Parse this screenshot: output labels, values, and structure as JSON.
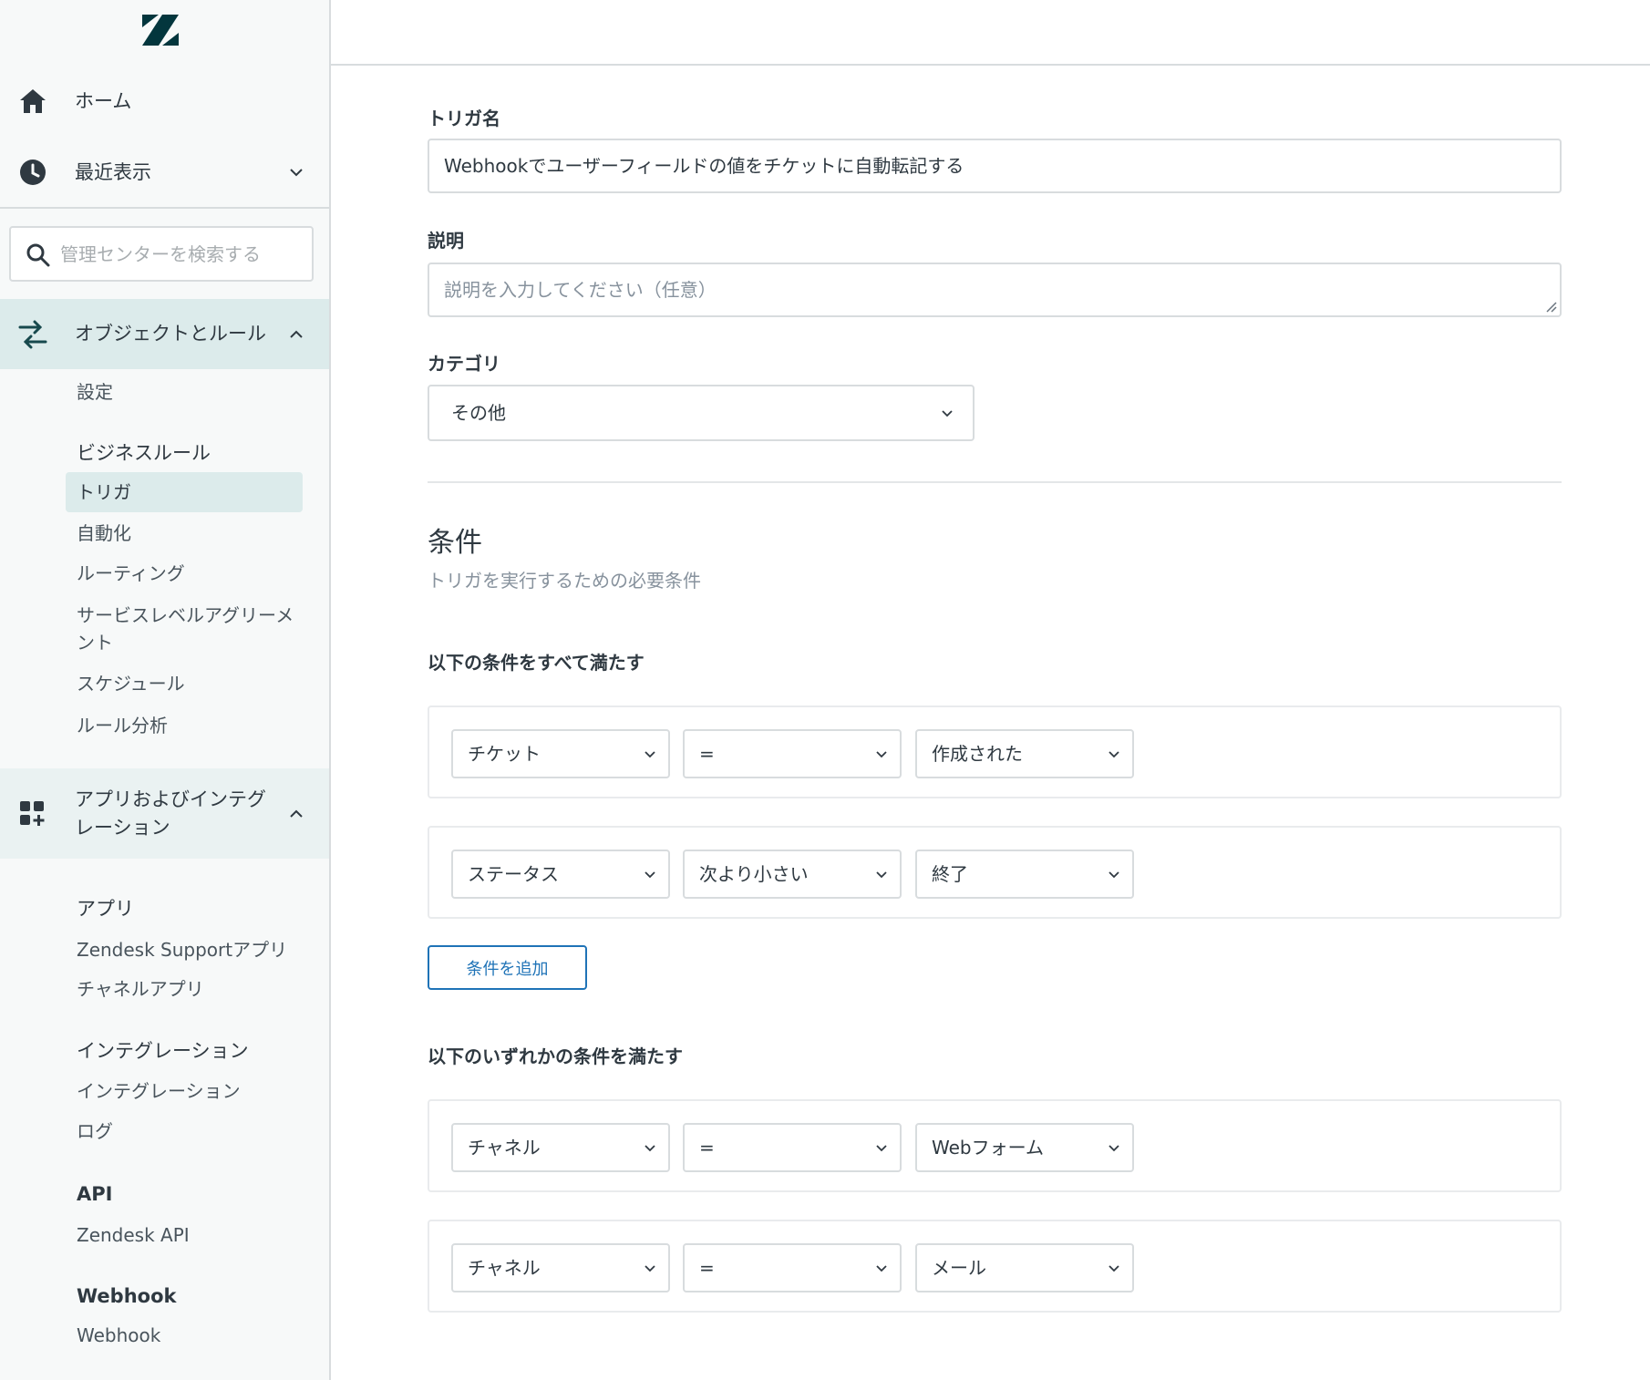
{
  "sidebar": {
    "home_label": "ホーム",
    "recent_label": "最近表示",
    "search_placeholder": "管理センターを検索する",
    "objects_rules_label": "オブジェクトとルール",
    "objects_items": {
      "settings": "設定",
      "business_rules_heading": "ビジネスルール",
      "triggers": "トリガ",
      "automations": "自動化",
      "routing": "ルーティング",
      "sla": "サービスレベルアグリーメント",
      "schedules": "スケジュール",
      "rule_analysis": "ルール分析"
    },
    "apps_label": "アプリおよびインテグレーション",
    "apps_items": {
      "apps_heading": "アプリ",
      "support_apps": "Zendesk Supportアプリ",
      "channel_apps": "チャネルアプリ",
      "integrations_heading": "インテグレーション",
      "integrations": "インテグレーション",
      "logs": "ログ",
      "api_heading": "API",
      "zendesk_api": "Zendesk API",
      "webhook_heading": "Webhook",
      "webhook": "Webhook"
    }
  },
  "form": {
    "trigger_name_label": "トリガ名",
    "trigger_name_value": "Webhookでユーザーフィールドの値をチケットに自動転記する",
    "description_label": "説明",
    "description_placeholder": "説明を入力してください（任意）",
    "category_label": "カテゴリ",
    "category_value": "その他"
  },
  "conditions": {
    "title": "条件",
    "subtitle": "トリガを実行するための必要条件",
    "all_heading": "以下の条件をすべて満たす",
    "all": [
      {
        "field": "チケット",
        "operator": "=",
        "value": "作成された"
      },
      {
        "field": "ステータス",
        "operator": "次より小さい",
        "value": "終了"
      }
    ],
    "add_button": "条件を追加",
    "any_heading": "以下のいずれかの条件を満たす",
    "any": [
      {
        "field": "チャネル",
        "operator": "=",
        "value": "Webフォーム"
      },
      {
        "field": "チャネル",
        "operator": "=",
        "value": "メール"
      }
    ]
  },
  "colors": {
    "accent": "#1f73b7",
    "active_bg": "#dcebeb",
    "border": "#d8dcde",
    "text": "#2f3941"
  }
}
